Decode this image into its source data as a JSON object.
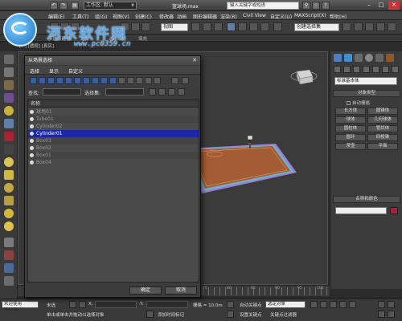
{
  "titlebar": {
    "workspace": "工作区: 默认",
    "filename": "篮球场.max",
    "search_placeholder": "键入关键字或短语",
    "menu_items": [
      "编辑(E)",
      "工具(T)",
      "组(G)",
      "视图(V)",
      "创建(C)",
      "修改器",
      "动画",
      "图形编辑器",
      "渲染(R)",
      "Civil View",
      "自定义(U)",
      "MAXScript(X)",
      "帮助(H)"
    ]
  },
  "watermark": {
    "cn_text": "河东软件网",
    "url": "www.pc0359.cn"
  },
  "toolbar": {
    "view_select": "视图",
    "selection_set": "创建选择集"
  },
  "ribbon": {
    "items": [
      "多边形建模",
      "选择",
      "对象绘制",
      "填充"
    ]
  },
  "viewport": {
    "label": "[+] [透视] [真实]"
  },
  "dialog": {
    "title": "从场景选择",
    "menu": [
      "选择",
      "显示",
      "自定义"
    ],
    "find_label": "查找:",
    "select_set_label": "选择集:",
    "column_header": "名称",
    "rows": [
      "球场01",
      "Tube01",
      "Cylinder02",
      "Cylinder01",
      "Box03",
      "Box02",
      "Box01",
      "Box04"
    ],
    "selected_row": "Cylinder01",
    "ok_label": "确定",
    "cancel_label": "取消"
  },
  "command_panel": {
    "type_dropdown": "标准基本体",
    "object_type_header": "对象类型",
    "autogrid_label": "自动栅格",
    "objects": [
      "长方体",
      "圆锥体",
      "球体",
      "几何球体",
      "圆柱体",
      "管状体",
      "圆环",
      "四棱锥",
      "茶壶",
      "平面"
    ],
    "name_color_header": "名称和颜色"
  },
  "timeline": {
    "ticks": [
      "75",
      "80",
      "85",
      "90",
      "95",
      "100"
    ]
  },
  "status": {
    "welcome": "欢迎使用 MAXSc",
    "selected": "未选",
    "x_label": "X:",
    "y_label": "Y:",
    "grid_label": "栅格 = 10.0m",
    "hint_text": "单击或单击并拖动以选择对象",
    "add_time_tag": "添加时间标记",
    "auto_key": "自动关键点",
    "set_key": "设置关键点",
    "selected_object_dropdown": "选定对象",
    "key_filter": "关键点过滤器"
  },
  "colors": {
    "selection_highlight": "#1c27a8",
    "court_floor": "#a45c34",
    "court_border": "#9a7fd4",
    "object_color_swatch": "#b01c3a"
  }
}
